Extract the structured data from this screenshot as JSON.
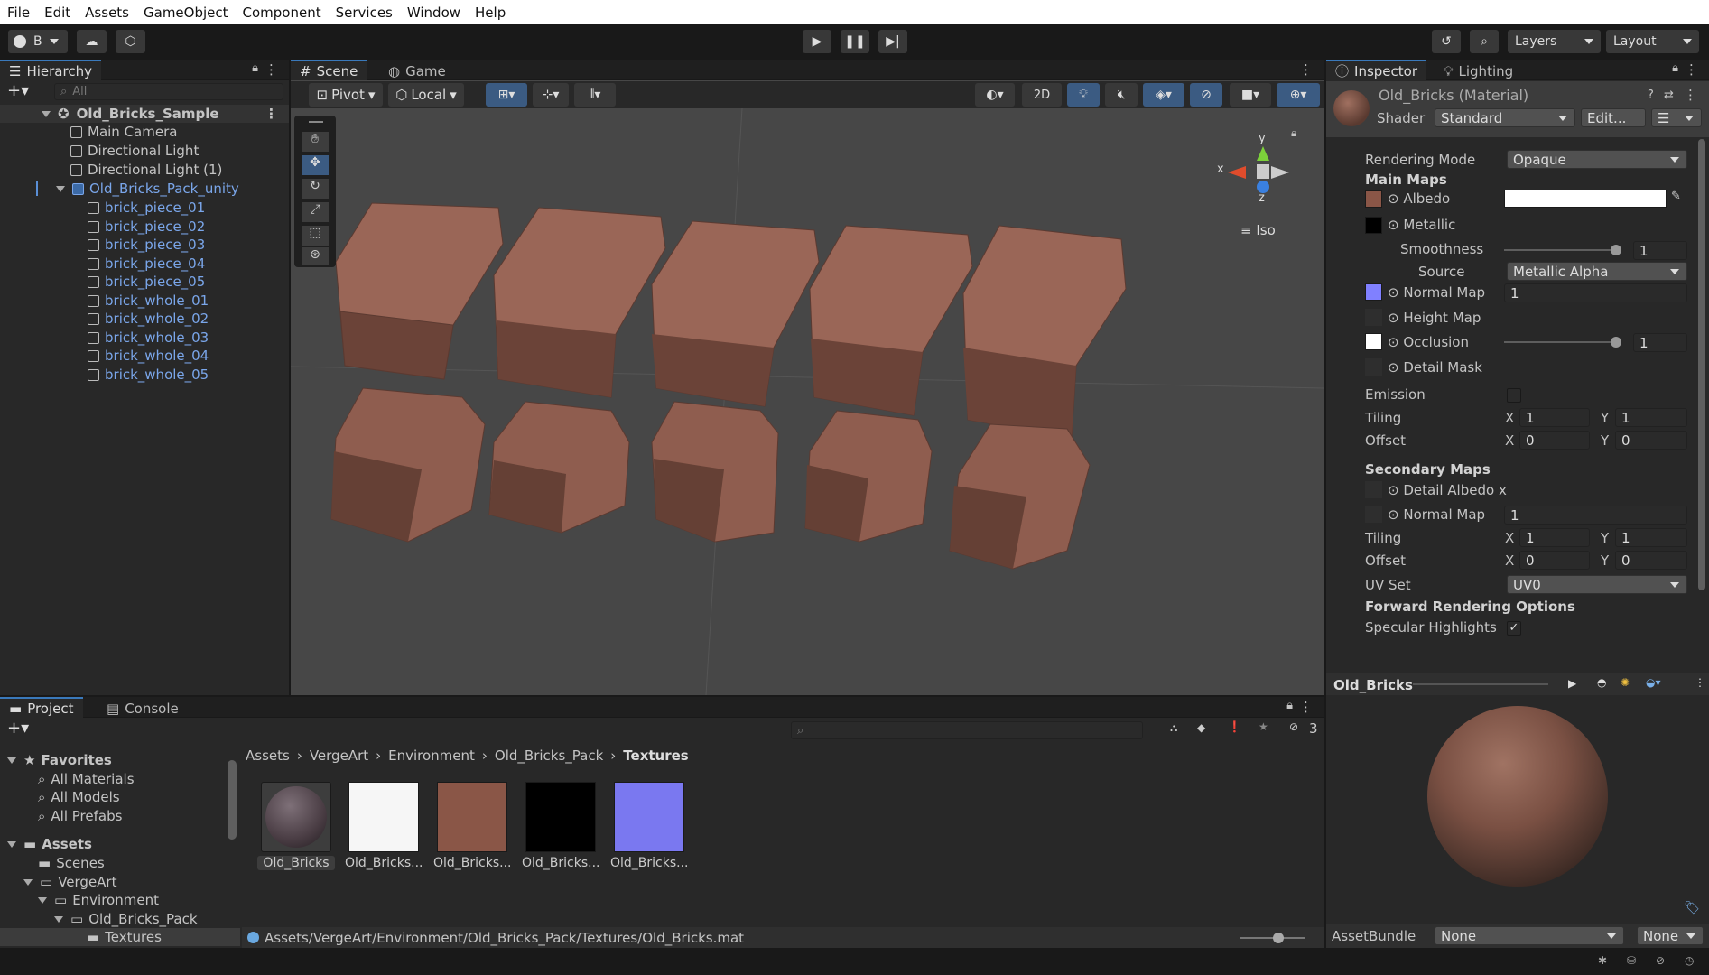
{
  "menu": [
    "File",
    "Edit",
    "Assets",
    "GameObject",
    "Component",
    "Services",
    "Window",
    "Help"
  ],
  "toolbar": {
    "account": "B",
    "layers": "Layers",
    "layout": "Layout"
  },
  "hierarchy": {
    "tab": "Hierarchy",
    "search_placeholder": "All",
    "scene": "Old_Bricks_Sample",
    "items": [
      "Main Camera",
      "Directional Light",
      "Directional Light (1)"
    ],
    "prefab": "Old_Bricks_Pack_unity",
    "children": [
      "brick_piece_01",
      "brick_piece_02",
      "brick_piece_03",
      "brick_piece_04",
      "brick_piece_05",
      "brick_whole_01",
      "brick_whole_02",
      "brick_whole_03",
      "brick_whole_04",
      "brick_whole_05"
    ]
  },
  "scene": {
    "tab_scene": "Scene",
    "tab_game": "Game",
    "pivot": "Pivot",
    "local": "Local",
    "mode_2d": "2D",
    "iso": "Iso",
    "axis_x": "x",
    "axis_y": "y",
    "axis_z": "z"
  },
  "inspector": {
    "tab": "Inspector",
    "tab_lighting": "Lighting",
    "material_name": "Old_Bricks (Material)",
    "shader_label": "Shader",
    "shader_value": "Standard",
    "edit_button": "Edit...",
    "rendering_mode_label": "Rendering Mode",
    "rendering_mode": "Opaque",
    "main_maps": "Main Maps",
    "albedo": "Albedo",
    "metallic": "Metallic",
    "smoothness": "Smoothness",
    "smoothness_value": "1",
    "source": "Source",
    "source_value": "Metallic Alpha",
    "normal_map": "Normal Map",
    "normal_value": "1",
    "height_map": "Height Map",
    "occlusion": "Occlusion",
    "occlusion_value": "1",
    "detail_mask": "Detail Mask",
    "emission": "Emission",
    "tiling": "Tiling",
    "offset": "Offset",
    "x": "X",
    "y": "Y",
    "tiling_x": "1",
    "tiling_y": "1",
    "offset_x": "0",
    "offset_y": "0",
    "secondary_maps": "Secondary Maps",
    "detail_albedo": "Detail Albedo x",
    "normal_map2": "Normal Map",
    "normal_value2": "1",
    "tiling2_x": "1",
    "tiling2_y": "1",
    "offset2_x": "0",
    "offset2_y": "0",
    "uv_set": "UV Set",
    "uv_value": "UV0",
    "forward": "Forward Rendering Options",
    "specular": "Specular Highlights",
    "preview_title": "Old_Bricks",
    "assetbundle": "AssetBundle",
    "ab_value": "None",
    "ab_variant": "None",
    "swatch_albedo": "#8a5647",
    "swatch_metallic": "#000000",
    "swatch_normal": "#8080ff",
    "swatch_occlusion": "#ffffff"
  },
  "project": {
    "tab": "Project",
    "tab_console": "Console",
    "hidden_count": "3",
    "favorites": "Favorites",
    "fav_items": [
      "All Materials",
      "All Models",
      "All Prefabs"
    ],
    "assets": "Assets",
    "tree": [
      "Scenes",
      "VergeArt",
      "Environment",
      "Old_Bricks_Pack",
      "Textures"
    ],
    "breadcrumb": [
      "Assets",
      "VergeArt",
      "Environment",
      "Old_Bricks_Pack",
      "Textures"
    ],
    "files": [
      "Old_Bricks",
      "Old_Bricks...",
      "Old_Bricks...",
      "Old_Bricks...",
      "Old_Bricks..."
    ],
    "path": "Assets/VergeArt/Environment/Old_Bricks_Pack/Textures/Old_Bricks.mat"
  }
}
